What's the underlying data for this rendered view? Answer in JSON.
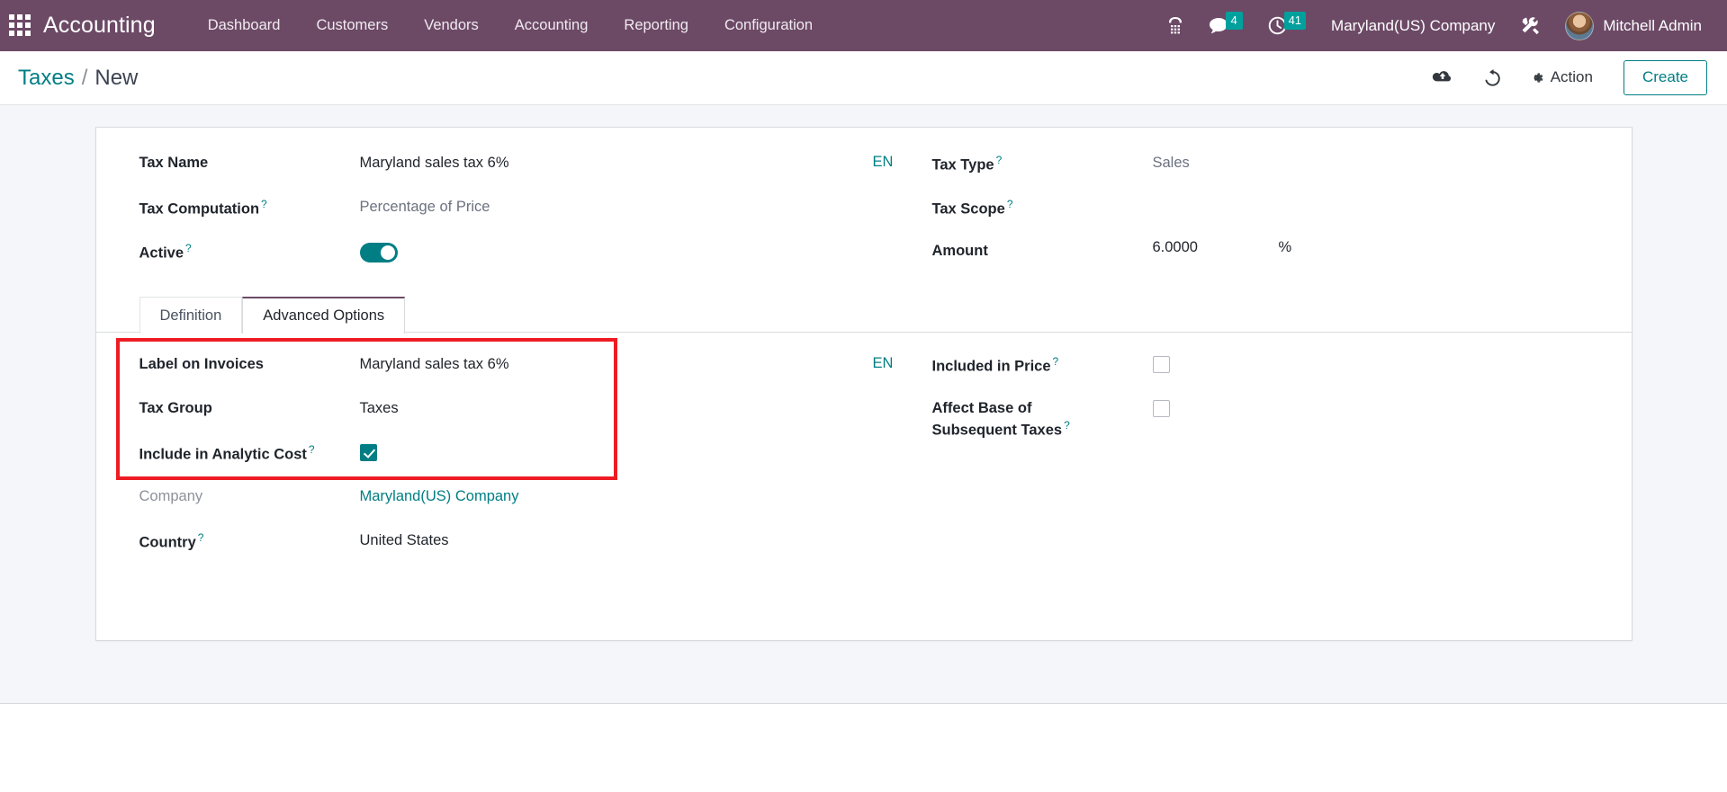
{
  "navbar": {
    "apps_icon": "apps-grid-icon",
    "brand": "Accounting",
    "menu": [
      {
        "label": "Dashboard"
      },
      {
        "label": "Customers"
      },
      {
        "label": "Vendors"
      },
      {
        "label": "Accounting"
      },
      {
        "label": "Reporting"
      },
      {
        "label": "Configuration"
      }
    ],
    "voip_icon": "phone-dialpad-icon",
    "messages_icon": "chat-bubble-icon",
    "messages_count": "4",
    "activities_icon": "clock-icon",
    "activities_count": "41",
    "company": "Maryland(US) Company",
    "debug_icon": "tools-wrench-icon",
    "avatar_icon": "user-avatar",
    "user": "Mitchell Admin"
  },
  "control_panel": {
    "breadcrumb_root": "Taxes",
    "breadcrumb_sep": "/",
    "breadcrumb_current": "New",
    "save_icon": "cloud-upload-icon",
    "discard_icon": "undo-arrow-icon",
    "action_icon": "gear-icon",
    "action_label": "Action",
    "create_label": "Create"
  },
  "form": {
    "lang_badge": "EN",
    "tax_name": {
      "label": "Tax Name",
      "value": "Maryland sales tax 6%"
    },
    "tax_computation": {
      "label": "Tax Computation",
      "value": "Percentage of Price"
    },
    "active": {
      "label": "Active",
      "value": "on"
    },
    "tax_type": {
      "label": "Tax Type",
      "value": "Sales"
    },
    "tax_scope": {
      "label": "Tax Scope",
      "value": ""
    },
    "amount": {
      "label": "Amount",
      "value": "6.0000",
      "suffix": "%"
    }
  },
  "tabs": [
    {
      "label": "Definition",
      "active": false
    },
    {
      "label": "Advanced Options",
      "active": true
    }
  ],
  "advanced_options": {
    "lang_badge": "EN",
    "label_on_invoices": {
      "label": "Label on Invoices",
      "value": "Maryland sales tax 6%"
    },
    "tax_group": {
      "label": "Tax Group",
      "value": "Taxes"
    },
    "include_in_analytic_cost": {
      "label": "Include in Analytic Cost",
      "checked": true
    },
    "company": {
      "label": "Company",
      "value": "Maryland(US) Company"
    },
    "country": {
      "label": "Country",
      "value": "United States"
    },
    "included_in_price": {
      "label": "Included in Price",
      "checked": false
    },
    "affect_base_line1": {
      "label": "Affect Base of"
    },
    "affect_base_line2": {
      "label": "Subsequent Taxes"
    }
  },
  "colors": {
    "navbar": "#6C4A66",
    "accent_teal": "#017E84",
    "badge_teal": "#00A09D",
    "annotation_red": "#ED1C24",
    "page_bg": "#f5f6fa"
  }
}
